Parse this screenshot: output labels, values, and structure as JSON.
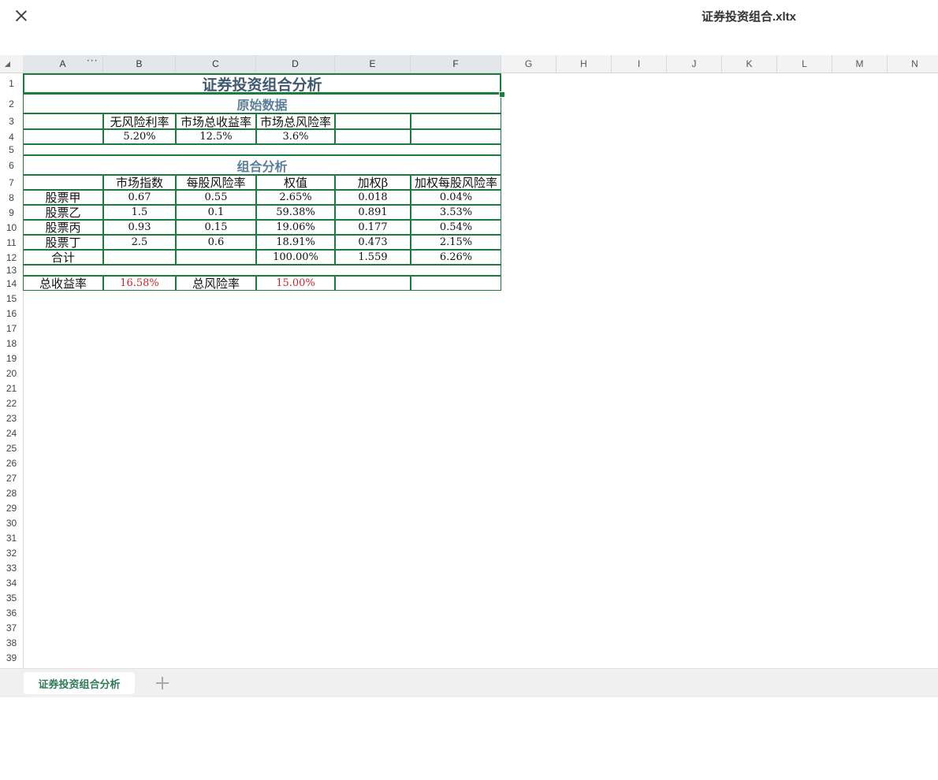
{
  "window": {
    "title": "证券投资组合.xltx"
  },
  "columns": [
    "A",
    "B",
    "C",
    "D",
    "E",
    "F",
    "G",
    "H",
    "I",
    "J",
    "K",
    "L",
    "M",
    "N"
  ],
  "rows": [
    "1",
    "2",
    "3",
    "4",
    "5",
    "6",
    "7",
    "8",
    "9",
    "10",
    "11",
    "12",
    "13",
    "14",
    "15",
    "16",
    "17",
    "18",
    "19",
    "20",
    "21",
    "22",
    "23",
    "24",
    "25",
    "26",
    "27",
    "28",
    "29",
    "30",
    "31",
    "32",
    "33",
    "34",
    "35",
    "36",
    "37",
    "38",
    "39"
  ],
  "col_more": "···",
  "sheet": {
    "title": "证券投资组合分析",
    "raw_section": "原始数据",
    "raw_headers": [
      "无风险利率",
      "市场总收益率",
      "市场总风险率"
    ],
    "raw_values": [
      "5.20%",
      "12.5%",
      "3.6%"
    ],
    "analysis_section": "组合分析",
    "analysis_headers": [
      "市场指数",
      "每股风险率",
      "权值",
      "加权β",
      "加权每股风险率"
    ],
    "stocks": [
      {
        "name": "股票甲",
        "index": "0.67",
        "risk": "0.55",
        "weight": "2.65%",
        "wbeta": "0.018",
        "wrisk": "0.04%"
      },
      {
        "name": "股票乙",
        "index": "1.5",
        "risk": "0.1",
        "weight": "59.38%",
        "wbeta": "0.891",
        "wrisk": "3.53%"
      },
      {
        "name": "股票丙",
        "index": "0.93",
        "risk": "0.15",
        "weight": "19.06%",
        "wbeta": "0.177",
        "wrisk": "0.54%"
      },
      {
        "name": "股票丁",
        "index": "2.5",
        "risk": "0.6",
        "weight": "18.91%",
        "wbeta": "0.473",
        "wrisk": "2.15%"
      }
    ],
    "total": {
      "label": "合计",
      "weight": "100.00%",
      "wbeta": "1.559",
      "wrisk": "6.26%"
    },
    "summary": {
      "return_label": "总收益率",
      "return_value": "16.58%",
      "risk_label": "总风险率",
      "risk_value": "15.00%"
    }
  },
  "tabs": [
    {
      "label": "证券投资组合分析",
      "active": true
    }
  ],
  "colors": {
    "accent": "#1e7b3e",
    "title": "#3f5a6e",
    "section": "#5b7f98",
    "highlight": "#d0262b",
    "tab_text": "#2e7c56"
  }
}
